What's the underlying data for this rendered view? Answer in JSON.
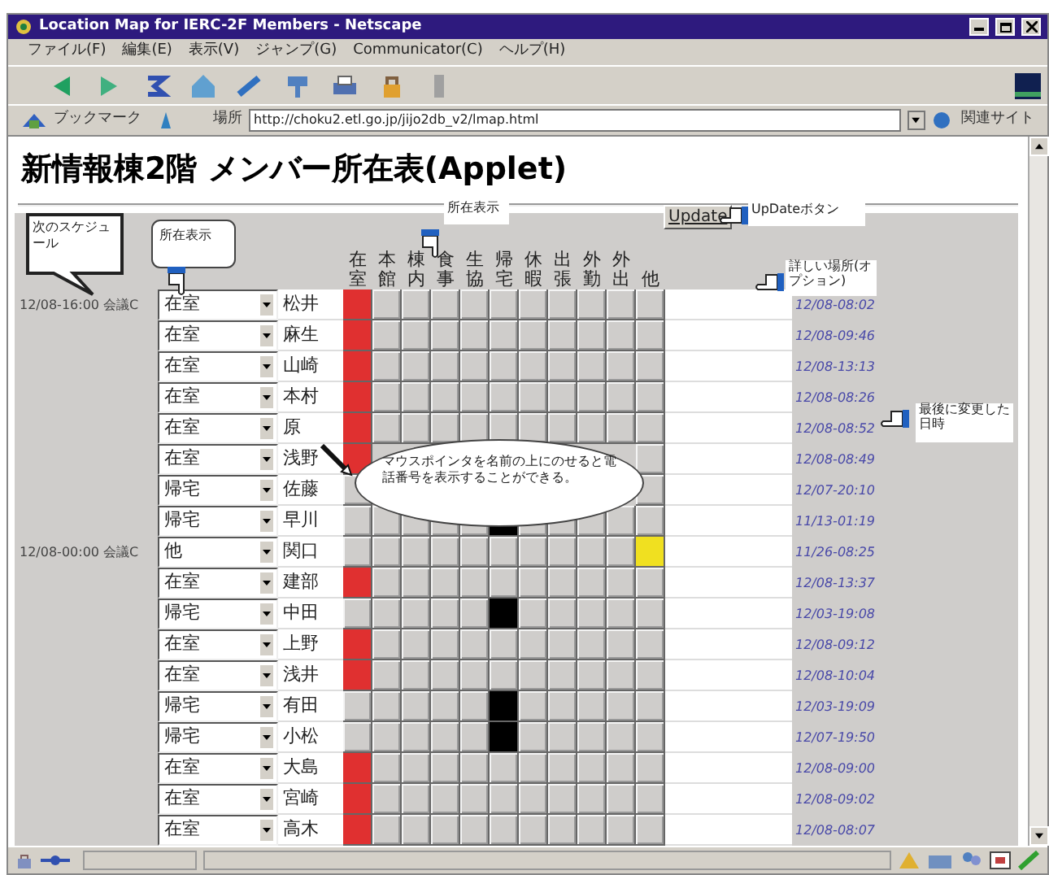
{
  "window": {
    "title": "Location Map for IERC-2F Members - Netscape"
  },
  "menu": [
    "ファイル(F)",
    "編集(E)",
    "表示(V)",
    "ジャンプ(G)",
    "Communicator(C)",
    "ヘルプ(H)"
  ],
  "location_bar": {
    "bookmarks": "ブックマーク",
    "label": "場所",
    "url": "http://choku2.etl.go.jp/jijo2db_v2/lmap.html",
    "related": "関連サイト"
  },
  "heading": "新情報棟2階 メンバー所在表(Applet)",
  "applet": {
    "update_button": "Update",
    "columns": [
      {
        "label": "在室",
        "color": "#e03030"
      },
      {
        "label": "本館"
      },
      {
        "label": "棟内"
      },
      {
        "label": "食事"
      },
      {
        "label": "生協"
      },
      {
        "label": "帰宅",
        "color": "#000000"
      },
      {
        "label": "休暇"
      },
      {
        "label": "出張"
      },
      {
        "label": "外勤"
      },
      {
        "label": "外出"
      },
      {
        "label": "他",
        "color": "#f0e020"
      }
    ],
    "rows": [
      {
        "schedule": "12/08-16:00 会議C",
        "status": "在室",
        "name": "松井",
        "cells": [
          true,
          false,
          false,
          false,
          false,
          false,
          false,
          false,
          false,
          false,
          false
        ],
        "time": "12/08-08:02"
      },
      {
        "status": "在室",
        "name": "麻生",
        "cells": [
          true,
          false,
          false,
          false,
          false,
          false,
          false,
          false,
          false,
          false,
          false
        ],
        "time": "12/08-09:46"
      },
      {
        "status": "在室",
        "name": "山崎",
        "cells": [
          true,
          false,
          false,
          false,
          false,
          false,
          false,
          false,
          false,
          false,
          false
        ],
        "time": "12/08-13:13"
      },
      {
        "status": "在室",
        "name": "本村",
        "cells": [
          true,
          false,
          false,
          false,
          false,
          false,
          false,
          false,
          false,
          false,
          false
        ],
        "time": "12/08-08:26"
      },
      {
        "status": "在室",
        "name": "原",
        "cells": [
          true,
          false,
          false,
          false,
          false,
          false,
          false,
          false,
          false,
          false,
          false
        ],
        "time": "12/08-08:52"
      },
      {
        "status": "在室",
        "name": "浅野",
        "cells": [
          true,
          null,
          null,
          null,
          null,
          null,
          null,
          null,
          null,
          null,
          false
        ],
        "time": "12/08-08:49"
      },
      {
        "status": "帰宅",
        "name": "佐藤",
        "cells": [
          false,
          null,
          null,
          null,
          null,
          null,
          null,
          null,
          null,
          null,
          false
        ],
        "time": "12/07-20:10"
      },
      {
        "status": "帰宅",
        "name": "早川",
        "cells": [
          false,
          false,
          false,
          false,
          false,
          true,
          false,
          false,
          false,
          false,
          false
        ],
        "time": "11/13-01:19"
      },
      {
        "schedule": "12/08-00:00 会議C",
        "status": "他",
        "name": "関口",
        "cells": [
          false,
          false,
          false,
          false,
          false,
          false,
          false,
          false,
          false,
          false,
          true
        ],
        "time": "11/26-08:25"
      },
      {
        "status": "在室",
        "name": "建部",
        "cells": [
          true,
          false,
          false,
          false,
          false,
          false,
          false,
          false,
          false,
          false,
          false
        ],
        "time": "12/08-13:37"
      },
      {
        "status": "帰宅",
        "name": "中田",
        "cells": [
          false,
          false,
          false,
          false,
          false,
          true,
          false,
          false,
          false,
          false,
          false
        ],
        "time": "12/03-19:08"
      },
      {
        "status": "在室",
        "name": "上野",
        "cells": [
          true,
          false,
          false,
          false,
          false,
          false,
          false,
          false,
          false,
          false,
          false
        ],
        "time": "12/08-09:12"
      },
      {
        "status": "在室",
        "name": "浅井",
        "cells": [
          true,
          false,
          false,
          false,
          false,
          false,
          false,
          false,
          false,
          false,
          false
        ],
        "time": "12/08-10:04"
      },
      {
        "status": "帰宅",
        "name": "有田",
        "cells": [
          false,
          false,
          false,
          false,
          false,
          true,
          false,
          false,
          false,
          false,
          false
        ],
        "time": "12/03-19:09"
      },
      {
        "status": "帰宅",
        "name": "小松",
        "cells": [
          false,
          false,
          false,
          false,
          false,
          true,
          false,
          false,
          false,
          false,
          false
        ],
        "time": "12/07-19:50"
      },
      {
        "status": "在室",
        "name": "大島",
        "cells": [
          true,
          false,
          false,
          false,
          false,
          false,
          false,
          false,
          false,
          false,
          false
        ],
        "time": "12/08-09:00"
      },
      {
        "status": "在室",
        "name": "宮崎",
        "cells": [
          true,
          false,
          false,
          false,
          false,
          false,
          false,
          false,
          false,
          false,
          false
        ],
        "time": "12/08-09:02"
      },
      {
        "status": "在室",
        "name": "高木",
        "cells": [
          true,
          false,
          false,
          false,
          false,
          false,
          false,
          false,
          false,
          false,
          false
        ],
        "time": "12/08-08:07"
      }
    ]
  },
  "annotations": [
    {
      "kind": "bubble",
      "text": "次のスケジュール"
    },
    {
      "kind": "bubble",
      "text": "所在表示"
    },
    {
      "kind": "label",
      "text": "所在表示"
    },
    {
      "kind": "label",
      "text": "UpDateボタン"
    },
    {
      "kind": "label",
      "text": "詳しい場所(オプション)"
    },
    {
      "kind": "label",
      "text": "最後に変更した日時"
    },
    {
      "kind": "ellipse",
      "text": "マウスポインタを名前の上にのせると電話番号を表示することができる。"
    }
  ]
}
